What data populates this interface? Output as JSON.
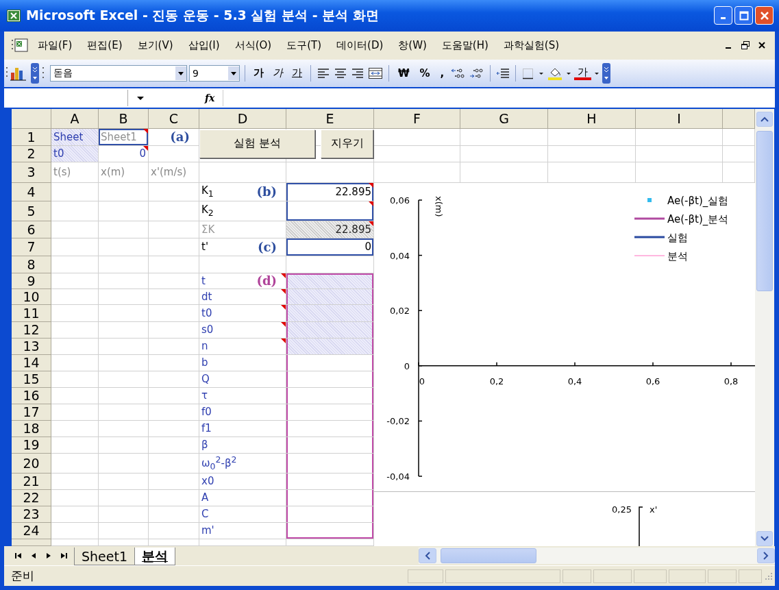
{
  "window": {
    "title": "Microsoft Excel - 진동 운동 - 5.3 실험 분석 - 분석 화면"
  },
  "menu": [
    "파일(F)",
    "편집(E)",
    "보기(V)",
    "삽입(I)",
    "서식(O)",
    "도구(T)",
    "데이터(D)",
    "창(W)",
    "도움말(H)",
    "과학실험(S)"
  ],
  "toolbar": {
    "font": "돋음",
    "size": "9",
    "bold": "가",
    "italic": "가",
    "underline": "가",
    "currency": "₩",
    "percent": "%",
    "comma": ",",
    "font_color": "가"
  },
  "formula_bar": {
    "fx": "fx"
  },
  "sheet": {
    "columns": [
      "A",
      "B",
      "C",
      "D",
      "E",
      "F",
      "G",
      "H",
      "I"
    ],
    "rows": [
      {
        "number": "1",
        "cells": {
          "A": {
            "text": "Sheet",
            "kind": "ref"
          },
          "B": {
            "text": "Sheet1",
            "kind": "ref-input",
            "framed": true,
            "comment": true
          },
          "C": {
            "tag": {
              "text": "(a)",
              "color": "#2f4f9f"
            }
          }
        }
      },
      {
        "number": "2",
        "cells": {
          "A": {
            "text": "t0",
            "kind": "ref"
          },
          "B": {
            "text": "0",
            "kind": "number",
            "comment": true
          }
        }
      },
      {
        "number": "3",
        "cells": {
          "A": {
            "text": "t(s)",
            "kind": "heading"
          },
          "B": {
            "text": "x(m)",
            "kind": "heading"
          },
          "C": {
            "text": "x'(m/s)",
            "kind": "heading"
          }
        }
      },
      {
        "number": "4",
        "cells": {
          "D": {
            "text": "K$_{1}$",
            "kind": "label",
            "tag": {
              "text": "(b)",
              "color": "#2f4f9f"
            }
          },
          "E": {
            "text": "22.895",
            "kind": "value",
            "framed": true,
            "comment": true
          }
        }
      },
      {
        "number": "5",
        "cells": {
          "D": {
            "text": "K$_{2}$",
            "kind": "label"
          },
          "E": {
            "kind": "value",
            "framed": true,
            "comment": true
          }
        }
      },
      {
        "number": "6",
        "cells": {
          "D": {
            "text": "ΣK",
            "kind": "label-dim"
          },
          "E": {
            "text": "22.895",
            "kind": "value-dim",
            "comment": true
          }
        }
      },
      {
        "number": "7",
        "cells": {
          "D": {
            "text": "t'",
            "kind": "label",
            "tag": {
              "text": "(c)",
              "color": "#2f4f9f"
            }
          },
          "E": {
            "text": "0",
            "kind": "value",
            "framed": true
          }
        }
      },
      {
        "number": "8",
        "cells": {}
      },
      {
        "number": "9",
        "cells": {
          "D": {
            "text": "t",
            "kind": "param",
            "comment": true,
            "tag": {
              "text": "(d)",
              "color": "#b0449a"
            }
          },
          "E": {
            "kind": "param-input",
            "framed": true
          }
        }
      },
      {
        "number": "10",
        "cells": {
          "D": {
            "text": "dt",
            "kind": "param",
            "comment": true
          },
          "E": {
            "kind": "param-input",
            "framed": true
          }
        }
      },
      {
        "number": "11",
        "cells": {
          "D": {
            "text": "t0",
            "kind": "param",
            "comment": true
          },
          "E": {
            "kind": "param-input",
            "framed": true
          }
        }
      },
      {
        "number": "12",
        "cells": {
          "D": {
            "text": "s0",
            "kind": "param",
            "comment": true
          },
          "E": {
            "kind": "param-input",
            "framed": true
          }
        }
      },
      {
        "number": "13",
        "cells": {
          "D": {
            "text": "n",
            "kind": "param",
            "comment": true
          },
          "E": {
            "kind": "param-input",
            "framed": true
          }
        }
      },
      {
        "number": "14",
        "cells": {
          "D": {
            "text": "b",
            "kind": "param"
          },
          "E": {
            "kind": "param-output",
            "framed": true
          }
        }
      },
      {
        "number": "15",
        "cells": {
          "D": {
            "text": "Q",
            "kind": "param"
          },
          "E": {
            "kind": "param-output",
            "framed": true
          }
        }
      },
      {
        "number": "16",
        "cells": {
          "D": {
            "text": "τ",
            "kind": "param"
          },
          "E": {
            "kind": "param-output",
            "framed": true
          }
        }
      },
      {
        "number": "17",
        "cells": {
          "D": {
            "text": "f0",
            "kind": "param"
          },
          "E": {
            "kind": "param-output",
            "framed": true
          }
        }
      },
      {
        "number": "18",
        "cells": {
          "D": {
            "text": "f1",
            "kind": "param"
          },
          "E": {
            "kind": "param-output",
            "framed": true
          }
        }
      },
      {
        "number": "19",
        "cells": {
          "D": {
            "text": "β",
            "kind": "param"
          },
          "E": {
            "kind": "param-output",
            "framed": true
          }
        }
      },
      {
        "number": "20",
        "cells": {
          "D": {
            "text": "ω$_{0}$$^{2}$-β$^{2}$",
            "kind": "param"
          },
          "E": {
            "kind": "param-output",
            "framed": true
          }
        }
      },
      {
        "number": "21",
        "cells": {
          "D": {
            "text": "x0",
            "kind": "param"
          },
          "E": {
            "kind": "param-output",
            "framed": true
          }
        }
      },
      {
        "number": "22",
        "cells": {
          "D": {
            "text": "A",
            "kind": "param"
          },
          "E": {
            "kind": "param-output",
            "framed": true
          }
        }
      },
      {
        "number": "23",
        "cells": {
          "D": {
            "text": "C",
            "kind": "param"
          },
          "E": {
            "kind": "param-output",
            "framed": true
          }
        }
      },
      {
        "number": "24",
        "cells": {
          "D": {
            "text": "m'",
            "kind": "param"
          },
          "E": {
            "kind": "param-output",
            "framed": true
          }
        }
      }
    ]
  },
  "buttons": [
    {
      "label": "실험 분석"
    },
    {
      "label": "지우기"
    }
  ],
  "charts": [
    {
      "chart_data": {
        "type": "scatter",
        "ylabel": "x(m)",
        "categories": [
          "0",
          "0,2",
          "0,4",
          "0,6",
          "0,8"
        ],
        "ylim": [
          -0.04,
          0.06
        ],
        "yticks": [
          {
            "value": -0.04,
            "label": "-0,04"
          },
          {
            "value": -0.02,
            "label": "-0,02"
          },
          {
            "value": 0,
            "label": "0"
          },
          {
            "value": 0.02,
            "label": "0,02"
          },
          {
            "value": 0.04,
            "label": "0,04"
          },
          {
            "value": 0.06,
            "label": "0,06"
          }
        ],
        "series": [
          {
            "name": "Ae(-βt)_실험",
            "color": "#33bbee",
            "values": [
              null,
              null,
              null,
              null,
              null
            ]
          },
          {
            "name": "Ae(-βt)_분석",
            "color": "#b04aa0",
            "values": [
              null,
              null,
              null,
              null,
              null
            ]
          },
          {
            "name": "실험",
            "color": "#2a4aa0",
            "values": [
              null,
              null,
              null,
              null,
              null
            ]
          },
          {
            "name": "분석",
            "color": "#ff88cc",
            "values": [
              null,
              null,
              null,
              null,
              null
            ]
          }
        ]
      },
      "legend_styles": [
        {
          "kind": "marker"
        },
        {
          "kind": "line"
        },
        {
          "kind": "line"
        },
        {
          "kind": "thin-line"
        }
      ]
    },
    {
      "axis_label": "x'",
      "tick_label": "0,25"
    }
  ],
  "sheet_tabs": [
    {
      "label": "Sheet1",
      "selected": false
    },
    {
      "label": "분석",
      "selected": true
    }
  ],
  "status_bar": {
    "text": "준비"
  }
}
